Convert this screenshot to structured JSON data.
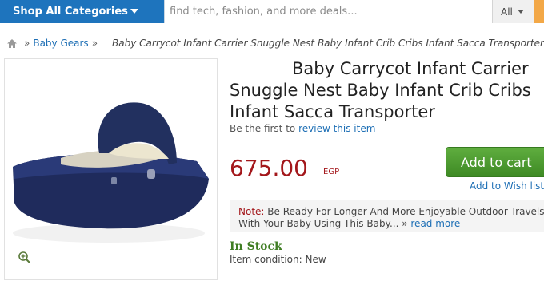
{
  "header": {
    "shop_all_label": "Shop All Categories",
    "search_placeholder": "find tech, fashion, and more deals...",
    "scope_label": "All"
  },
  "breadcrumb": {
    "sep": "»",
    "category": "Baby Gears",
    "current": "Baby Carrycot Infant Carrier Snuggle Nest Baby Infant Crib Cribs Infant Sacca Transporter"
  },
  "product": {
    "title_line1": "Baby Carrycot Infant Carrier",
    "title_line2": "Snuggle Nest Baby Infant Crib Cribs",
    "title_line3": "Infant Sacca Transporter",
    "review_prefix": "Be the first to",
    "review_link": "review this item",
    "price": "675.00",
    "currency": "EGP",
    "add_to_cart": "Add to cart",
    "add_to_wishlist": "Add to Wish list",
    "note_label": "Note:",
    "note_text1": "Be Ready For Longer And More Enjoyable Outdoor Travels",
    "note_text2": "With Your Baby Using This Baby...",
    "note_more_sep": "»",
    "note_more": "read more",
    "stock": "In Stock",
    "condition": "Item condition: New"
  },
  "colors": {
    "header_blue": "#1e74bd",
    "price_red": "#a3171b",
    "cart_green": "#4f9e33",
    "link_blue": "#1e6fb5",
    "stock_green": "#3f7d23"
  },
  "icons": {
    "home": "home-icon",
    "zoom": "zoom-in-icon",
    "chevron": "chevron-down-icon"
  }
}
